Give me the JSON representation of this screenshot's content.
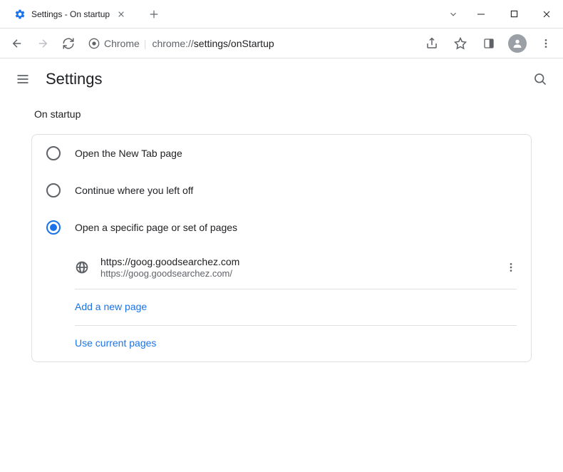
{
  "window": {
    "tab_title": "Settings - On startup",
    "chrome_label": "Chrome",
    "url_prefix": "chrome://",
    "url_path": "settings/onStartup"
  },
  "header": {
    "title": "Settings"
  },
  "section": {
    "title": "On startup"
  },
  "radios": {
    "option1": "Open the New Tab page",
    "option2": "Continue where you left off",
    "option3": "Open a specific page or set of pages",
    "selected": 2
  },
  "pages": [
    {
      "name": "https://goog.goodsearchez.com",
      "url": "https://goog.goodsearchez.com/"
    }
  ],
  "actions": {
    "add_page": "Add a new page",
    "use_current": "Use current pages"
  }
}
